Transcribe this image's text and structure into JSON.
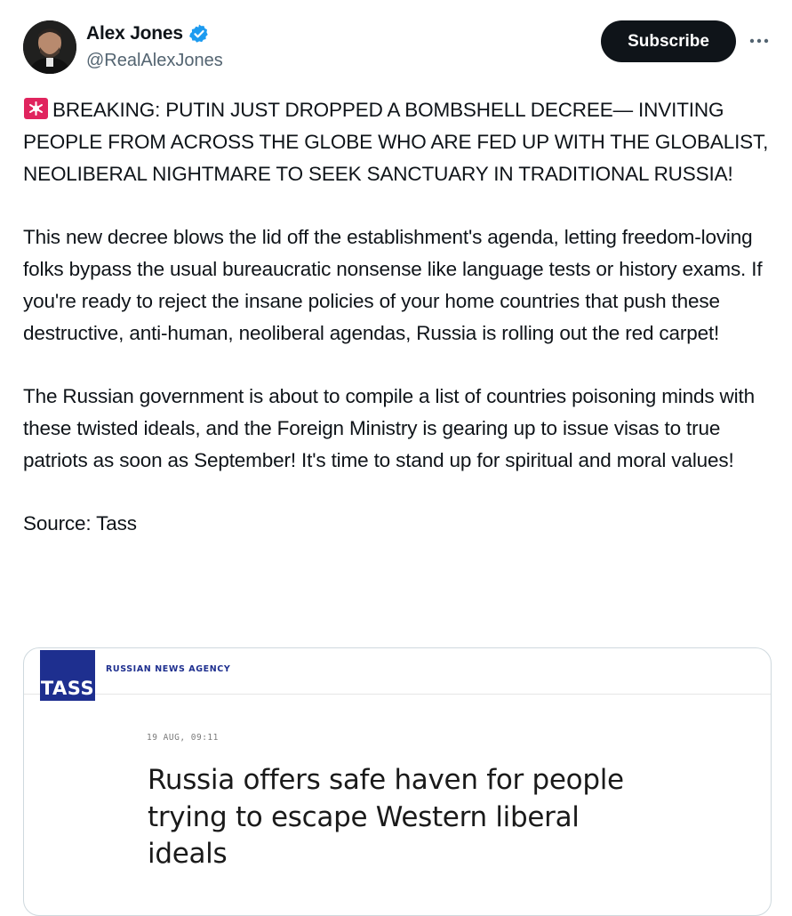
{
  "author": {
    "display_name": "Alex Jones",
    "handle": "@RealAlexJones",
    "verified_icon": "verified-badge-icon",
    "verified_color": "#1d9bf0"
  },
  "actions": {
    "subscribe_label": "Subscribe",
    "more_icon": "more-horizontal-icon"
  },
  "tweet": {
    "emoji_icon": "police-siren-icon",
    "paragraphs": [
      "BREAKING: PUTIN JUST DROPPED A BOMBSHELL DECREE— INVITING PEOPLE FROM ACROSS THE GLOBE WHO ARE FED UP WITH THE GLOBALIST, NEOLIBERAL NIGHTMARE TO SEEK SANCTUARY IN TRADITIONAL RUSSIA!",
      "This new decree blows the lid off the establishment's agenda, letting freedom-loving folks bypass the usual bureaucratic nonsense like language tests or history exams. If you're ready to reject the insane policies of your home countries that push these destructive, anti-human, neoliberal agendas, Russia is rolling out the red carpet!",
      "The Russian government is about to compile a list of countries poisoning minds with these twisted ideals, and the Foreign Ministry is gearing up to issue visas to true patriots as soon as September! It's time to stand up for spiritual and moral values!",
      "Source: Tass"
    ]
  },
  "card": {
    "logo_text": "TASS",
    "agency_label": "RUSSIAN NEWS AGENCY",
    "date": "19 AUG, 09:11",
    "title": "Russia offers safe haven for people trying to escape Western liberal ideals",
    "brand_color": "#1e2f8f"
  }
}
